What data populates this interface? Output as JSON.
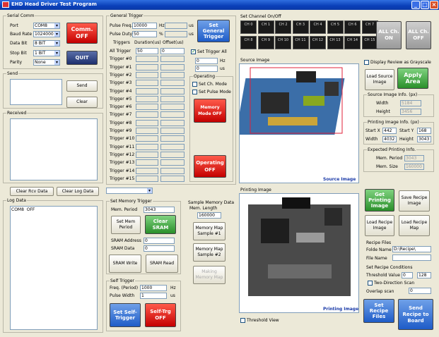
{
  "window": {
    "title": "EHD Head Driver Test Program"
  },
  "serial": {
    "label": "Serial Comm",
    "port_l": "Port",
    "port": "COM8",
    "baud_l": "Baud Rate",
    "baud": "1024000",
    "data_l": "Data Bit",
    "data": "8 BIT",
    "stop_l": "Stop Bit",
    "stop": "1 BIT",
    "parity_l": "Parity",
    "parity": "None",
    "comm_btn": "Comm. OFF",
    "quit_btn": "QUIT"
  },
  "send": {
    "label": "Send",
    "send_btn": "Send",
    "clear_btn": "Clear"
  },
  "received": {
    "label": "Received"
  },
  "logs": {
    "clear_rcv": "Clear Rcv Data",
    "clear_log": "Clear Log Data",
    "label": "Log Data",
    "text": "COM8  OFF"
  },
  "gen": {
    "label": "General Trigger",
    "freq_l": "Pulse Freq.",
    "freq": "10000",
    "freq_u": "Hz",
    "freq_us": "us",
    "duty_l": "Pulse Duty",
    "duty": "50",
    "duty_u": "%",
    "duty_us": "us",
    "set_btn": "Set General Trigger",
    "col_trig": "Triggers",
    "col_dur": "Duration(us)",
    "col_off": "Offset(us)",
    "rows": [
      {
        "n": "All Trigger",
        "d": "50",
        "o": "0"
      },
      {
        "n": "Trigger #0",
        "d": "",
        "o": ""
      },
      {
        "n": "Trigger #1",
        "d": "",
        "o": ""
      },
      {
        "n": "Trigger #2",
        "d": "",
        "o": ""
      },
      {
        "n": "Trigger #3",
        "d": "",
        "o": ""
      },
      {
        "n": "Trigger #4",
        "d": "",
        "o": ""
      },
      {
        "n": "Trigger #5",
        "d": "",
        "o": ""
      },
      {
        "n": "Trigger #6",
        "d": "",
        "o": ""
      },
      {
        "n": "Trigger #7",
        "d": "",
        "o": ""
      },
      {
        "n": "Trigger #8",
        "d": "",
        "o": ""
      },
      {
        "n": "Trigger #9",
        "d": "",
        "o": ""
      },
      {
        "n": "Trigger #10",
        "d": "",
        "o": ""
      },
      {
        "n": "Trigger #11",
        "d": "",
        "o": ""
      },
      {
        "n": "Trigger #12",
        "d": "",
        "o": ""
      },
      {
        "n": "Trigger #13",
        "d": "",
        "o": ""
      },
      {
        "n": "Trigger #14",
        "d": "",
        "o": ""
      },
      {
        "n": "Trigger #15",
        "d": "",
        "o": ""
      }
    ],
    "set_all": "Set Trigger All",
    "hz": "Hz",
    "us": "us",
    "v1": "0",
    "v2": "0",
    "operating": "Operating",
    "set_ch_mode": "Set Ch. Mode",
    "set_pulse_mode": "Set Pulse Mode",
    "mem_mode": "Memory Mode OFF",
    "op_btn": "Operating OFF"
  },
  "mem": {
    "label": "Set Memory Trigger",
    "period_l": "Mem. Period",
    "period": "3043",
    "set_period": "Set Mem Period",
    "clear_sram": "Clear SRAM",
    "addr_l": "SRAM Address",
    "addr": "0",
    "data_l": "SRAM Data",
    "data": "0",
    "write": "SRAM Write",
    "read": "SRAM Read"
  },
  "sample": {
    "label": "Sample Memory Data",
    "len_l": "Mem. Length",
    "len": "160000",
    "s1": "Memory Map Sample #1",
    "s2": "Memory Map Sample #2",
    "make": "Making Memory Map"
  },
  "self": {
    "label": "Self Trigger",
    "freq_l": "Freq. (Period)",
    "freq": "1000",
    "freq_u": "Hz",
    "width_l": "Pulse Width",
    "width": "1",
    "width_u": "us",
    "set_btn": "Set Self-Trigger",
    "off_btn": "Self-Trg OFF"
  },
  "channels": {
    "label": "Set Channel On/Off",
    "row1": [
      "CH 0",
      "CH 1",
      "CH 2",
      "CH 3",
      "CH 4",
      "CH 5",
      "CH 6",
      "CH 7"
    ],
    "row2": [
      "CH 8",
      "CH 9",
      "CH 10",
      "CH 11",
      "CH 12",
      "CH 13",
      "CH 14",
      "CH 15"
    ],
    "all_on": "ALL Ch. ON",
    "all_off": "ALL Ch. OFF"
  },
  "source": {
    "label": "Source Image",
    "caption": "Source Image",
    "grayscale": "Display Review as Grayscale",
    "load": "Load Source Image",
    "apply": "Apply Area",
    "info": "Source Image Info. (px)",
    "w_l": "Width",
    "w": "5184",
    "h_l": "Height",
    "h": "3456"
  },
  "printing": {
    "label": "Printing Image",
    "caption": "Printing Image",
    "threshold_view": "Threshold View",
    "info": "Printing Image Info. (px)",
    "sx_l": "Start X",
    "sx": "442",
    "sy_l": "Start Y",
    "sy": "168",
    "w_l": "Width",
    "w": "4032",
    "h_l": "Height",
    "h": "3043",
    "exp": "Expected Printing Info.",
    "mp_l": "Mem. Period",
    "mp": "3043",
    "ms_l": "Mem. Size",
    "ms": "160000"
  },
  "recipe": {
    "get": "Get Printing Image",
    "save": "Save Recipe Image",
    "load_img": "Load Recipe Image",
    "load_map": "Load Recipe Map",
    "files": "Recipe Files",
    "folder_l": "Folde Name",
    "folder": "D:\\Recipe\\",
    "file_l": "File Name",
    "file": "",
    "cond": "Set Recipe Conditions",
    "thr_l": "Threshold Value",
    "thr_a": "0",
    "thr_b": "128",
    "two_dir": "Two-Direction Scan",
    "overlap_l": "Overlap scan",
    "overlap": "0",
    "set_files": "Set Recipe Files",
    "send": "Send Recipe to Board"
  }
}
